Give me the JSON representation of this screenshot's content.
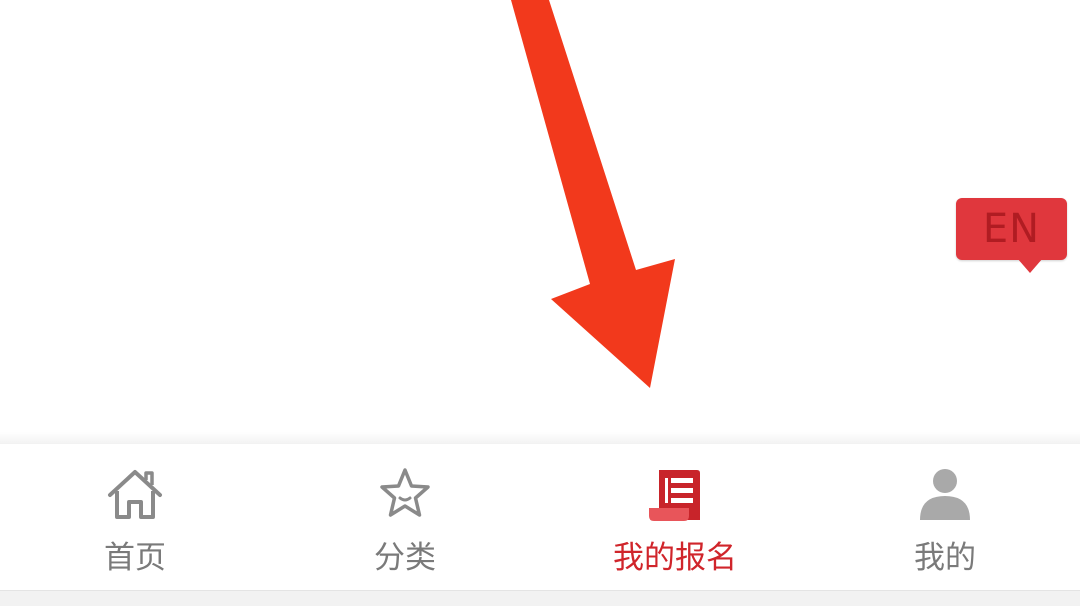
{
  "language_badge": {
    "label": "EN"
  },
  "tabbar": {
    "active_index": 2,
    "tabs": [
      {
        "label": "首页",
        "icon": "home-icon"
      },
      {
        "label": "分类",
        "icon": "star-icon"
      },
      {
        "label": "我的报名",
        "icon": "registration-document-icon"
      },
      {
        "label": "我的",
        "icon": "user-avatar-icon"
      }
    ]
  },
  "colors": {
    "accent": "#d0252b",
    "inactive": "#7a7a7a",
    "badge": "#e0373d",
    "arrow": "#f2391c"
  }
}
